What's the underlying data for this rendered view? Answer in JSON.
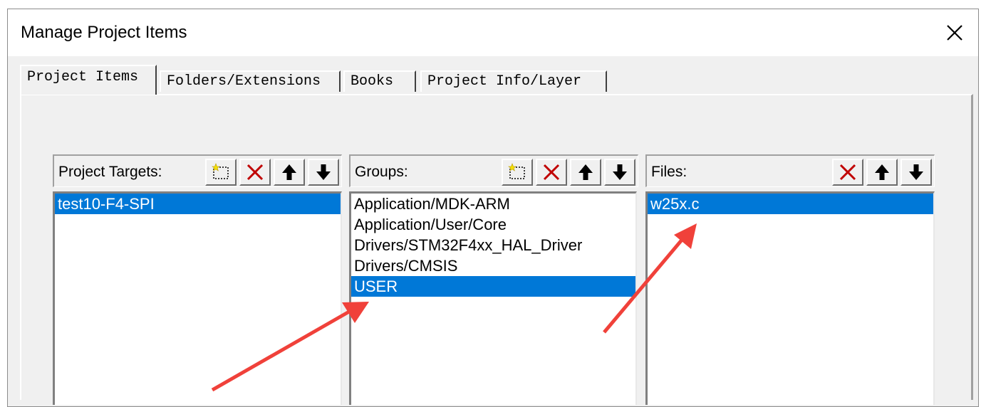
{
  "window": {
    "title": "Manage Project Items"
  },
  "tabs": [
    {
      "label": "Project Items",
      "active": true
    },
    {
      "label": "Folders/Extensions",
      "active": false
    },
    {
      "label": "Books",
      "active": false
    },
    {
      "label": "Project Info/Layer",
      "active": false
    }
  ],
  "targets": {
    "label": "Project Targets:",
    "items": [
      "test10-F4-SPI"
    ],
    "selected": "test10-F4-SPI"
  },
  "groups": {
    "label": "Groups:",
    "items": [
      "Application/MDK-ARM",
      "Application/User/Core",
      "Drivers/STM32F4xx_HAL_Driver",
      "Drivers/CMSIS",
      "USER"
    ],
    "selected": "USER"
  },
  "files": {
    "label": "Files:",
    "items": [
      "w25x.c"
    ],
    "selected": "w25x.c"
  },
  "colors": {
    "selection": "#0078d7",
    "delete_red": "#c00000",
    "annotation_arrow": "#f0413a"
  },
  "icons": {
    "new": "new-item-icon",
    "delete": "delete-icon",
    "up": "arrow-up-icon",
    "down": "arrow-down-icon",
    "close": "close-icon"
  }
}
